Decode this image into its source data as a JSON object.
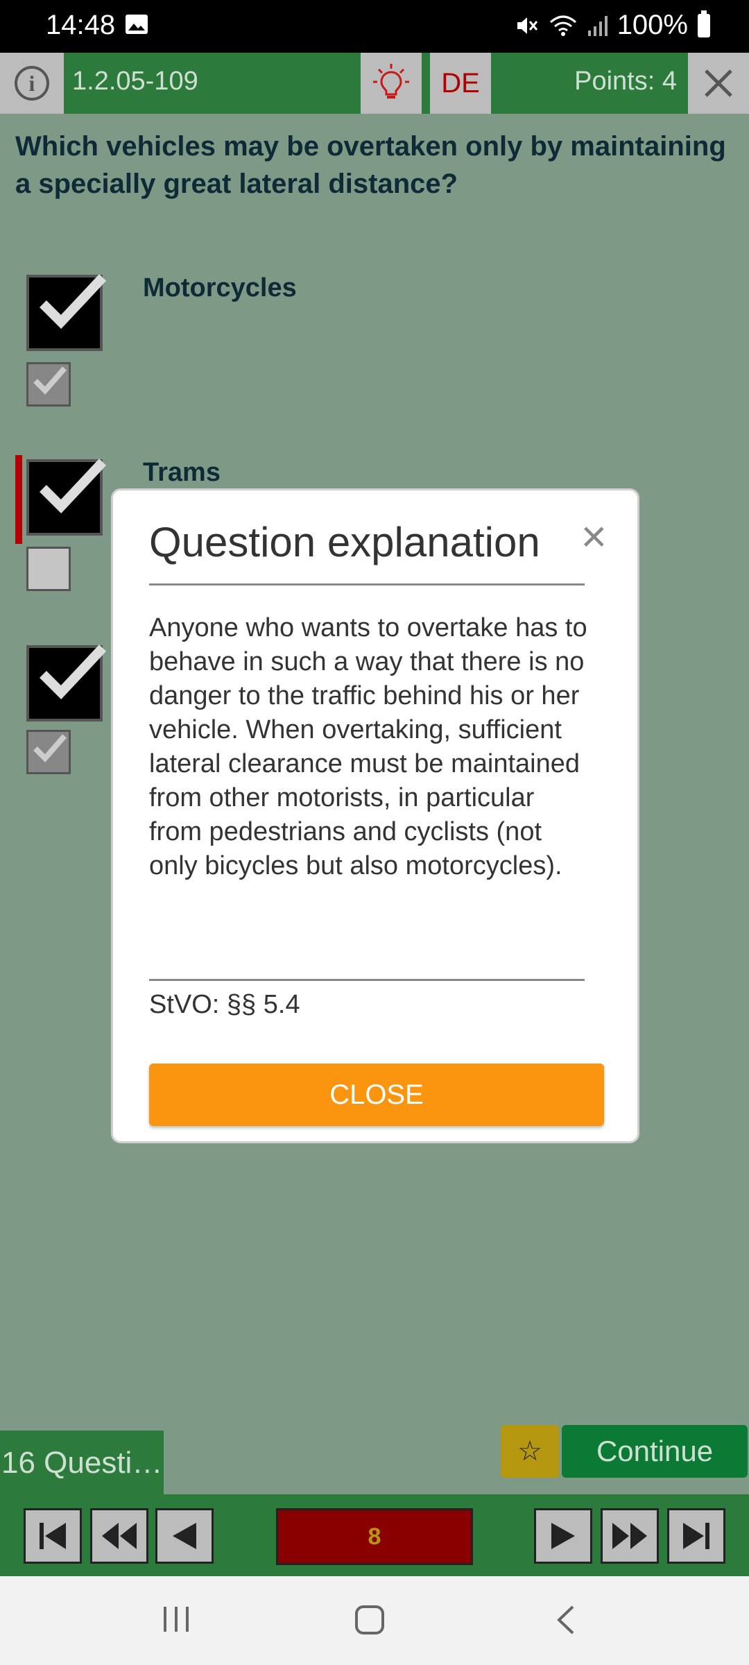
{
  "status_bar": {
    "time": "14:48",
    "battery": "100%"
  },
  "toolbar": {
    "question_id": "1.2.05-109",
    "language": "DE",
    "points": "Points: 4"
  },
  "question": {
    "text": "Which vehicles may be overtaken only by maintaining a specially great lateral distance?"
  },
  "answers": [
    {
      "label": "Motorcycles",
      "user_checked": true,
      "solution_checked": true
    },
    {
      "label": "Trams",
      "user_checked": true,
      "solution_checked": false
    },
    {
      "label": "",
      "user_checked": true,
      "solution_checked": true
    }
  ],
  "dialog": {
    "title": "Question explanation",
    "body": "Anyone who wants to overtake has to behave in such a way that there is no danger to the traffic behind his or her vehicle. When overtaking, sufficient lateral clearance must be maintained from other motorists, in particular from pedestrians and cyclists (not only bicycles but also motorcycles).",
    "reference": "StVO: §§ 5.4",
    "close_label": "CLOSE"
  },
  "footer": {
    "question_count": "16 Questi…",
    "continue_label": "Continue",
    "current_question": "8"
  },
  "colors": {
    "toolbar_green": "#2d7b3c",
    "background": "#7e9a86",
    "close_orange": "#fb940f",
    "page_red": "#8a0000"
  },
  "icons": [
    "info-icon",
    "lightbulb-icon",
    "close-icon",
    "star-icon",
    "first-icon",
    "rewind-icon",
    "prev-icon",
    "next-icon",
    "fast-forward-icon",
    "last-icon"
  ]
}
